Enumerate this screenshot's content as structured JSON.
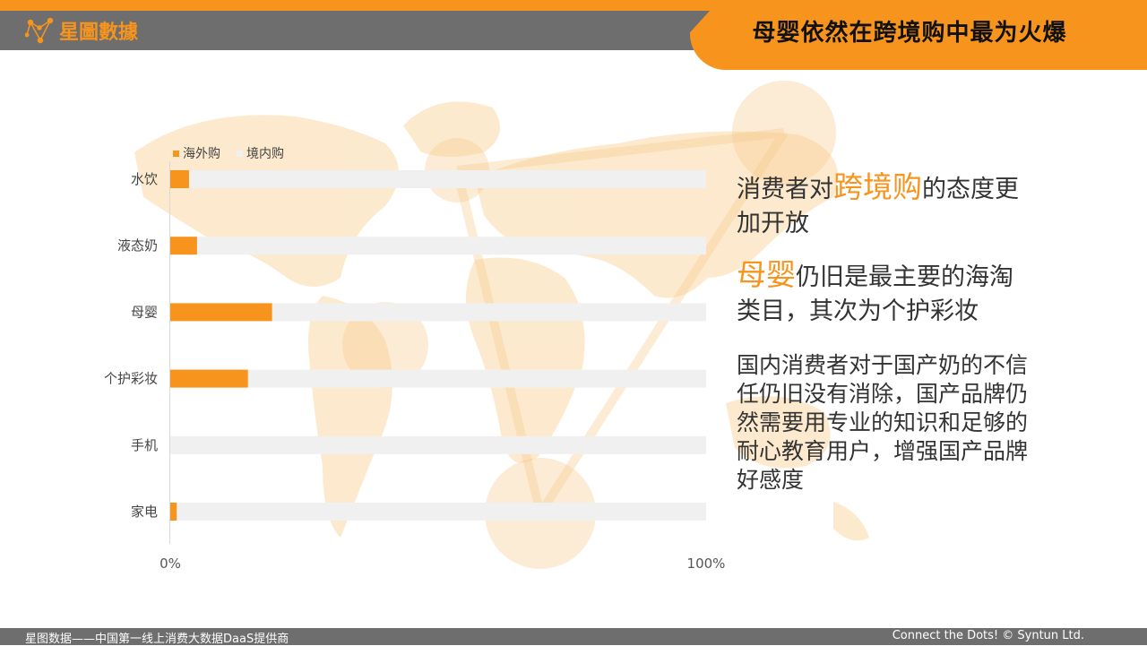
{
  "header": {
    "logo_text": "星圖數據",
    "title": "母婴依然在跨境购中最为火爆"
  },
  "colors": {
    "accent": "#F7941D",
    "gray_bar": "#6E6E6E",
    "track": "#F0F0F0"
  },
  "chart_data": {
    "type": "bar",
    "orientation": "horizontal-stacked-100",
    "categories": [
      "水饮",
      "液态奶",
      "母婴",
      "个护彩妆",
      "手机",
      "家电"
    ],
    "series": [
      {
        "name": "海外购",
        "values": [
          3.5,
          5,
          19,
          14.5,
          0,
          1.2
        ]
      },
      {
        "name": "境内购",
        "values": [
          96.5,
          95,
          81,
          85.5,
          100,
          98.8
        ]
      }
    ],
    "xlim": [
      0,
      100
    ],
    "tick_labels": [
      "0%",
      "100%"
    ],
    "legend_position": "top-left"
  },
  "right_text": {
    "p1_pre": "消费者对",
    "p1_hl": "跨境购",
    "p1_post": "的态度更加开放",
    "p2_hl": "母婴",
    "p2_post": "仍旧是最主要的海淘类目，其次为个护彩妆",
    "p3": "国内消费者对于国产奶的不信任仍旧没有消除，国产品牌仍然需要用专业的知识和足够的耐心教育用户，增强国产品牌好感度"
  },
  "footer": {
    "left": "星图数据——中国第一线上消费大数据DaaS提供商",
    "right": "Connect the Dots! © Syntun Ltd."
  }
}
